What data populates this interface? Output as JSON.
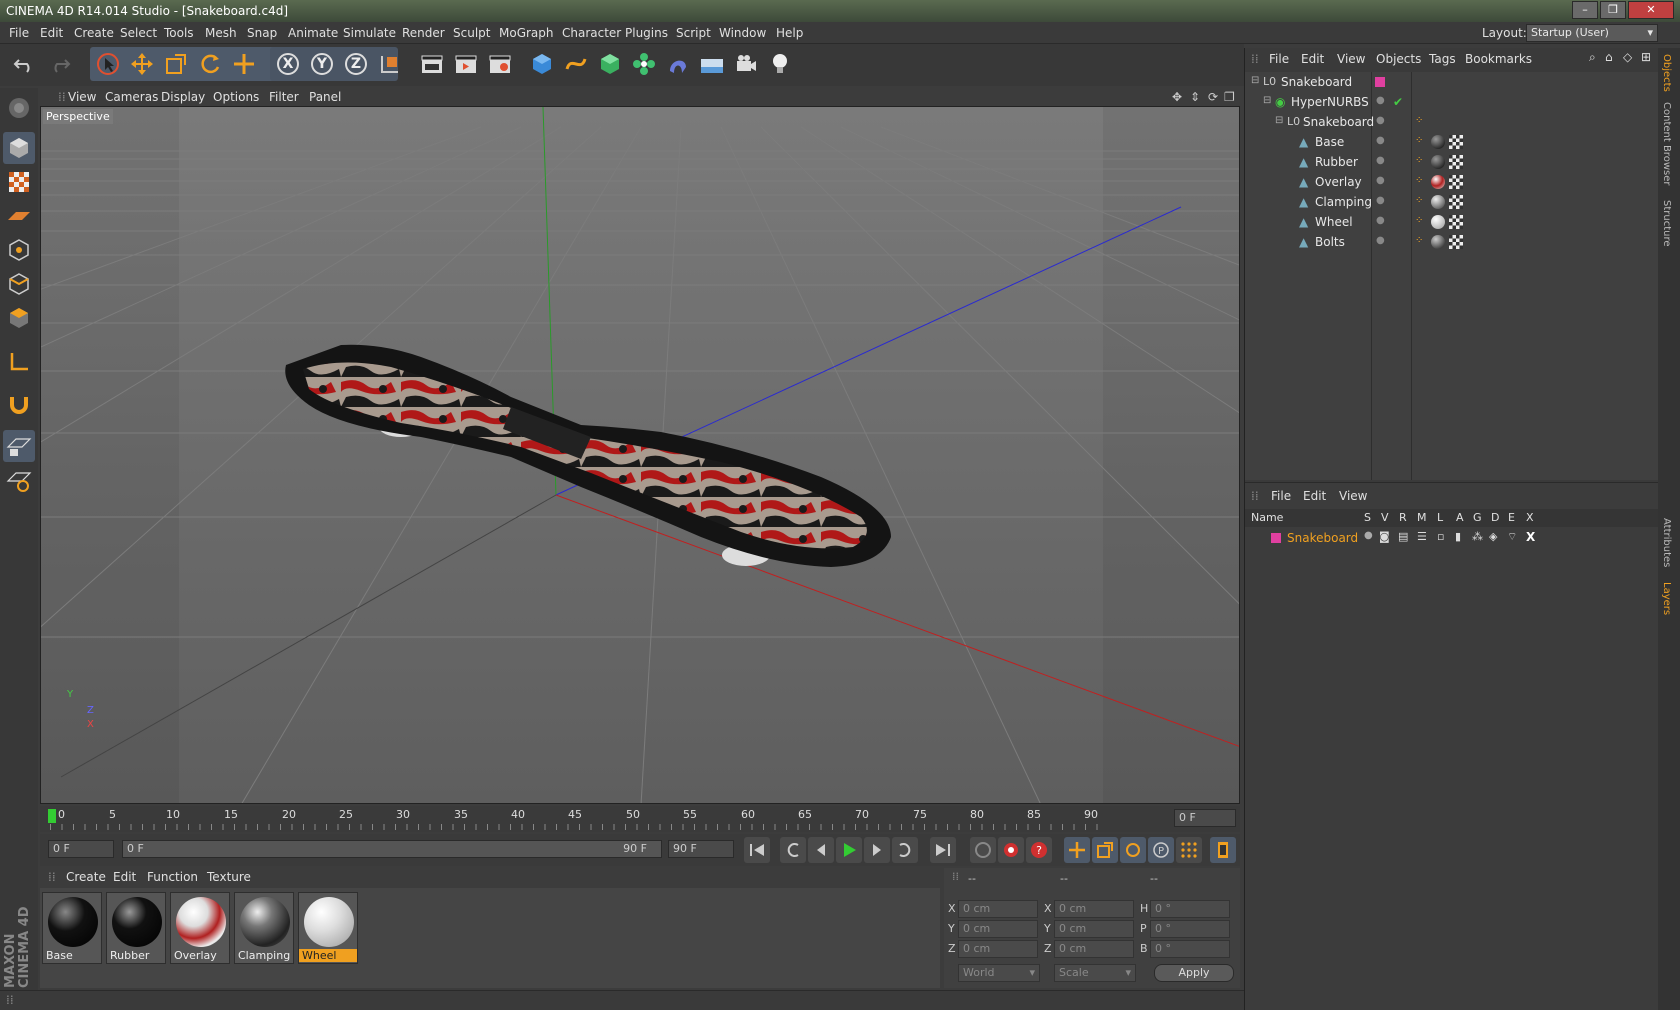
{
  "window": {
    "title": "CINEMA 4D R14.014 Studio - [Snakeboard.c4d]",
    "minimize": "–",
    "maximize": "❐",
    "close": "✕"
  },
  "menubar": [
    "File",
    "Edit",
    "Create",
    "Select",
    "Tools",
    "Mesh",
    "Snap",
    "Animate",
    "Simulate",
    "Render",
    "Sculpt",
    "MoGraph",
    "Character",
    "Plugins",
    "Script",
    "Window",
    "Help"
  ],
  "layout": {
    "label": "Layout:",
    "value": "Startup (User)"
  },
  "toolbar": {
    "axis_x": "X",
    "axis_y": "Y",
    "axis_z": "Z"
  },
  "viewport": {
    "menu": [
      "View",
      "Cameras",
      "Display",
      "Options",
      "Filter",
      "Panel"
    ],
    "label": "Perspective",
    "axis_y": "Y",
    "axis_z": "Z",
    "axis_x": "X"
  },
  "timeline": {
    "ticks": [
      "0",
      "5",
      "10",
      "15",
      "20",
      "25",
      "30",
      "35",
      "40",
      "45",
      "50",
      "55",
      "60",
      "65",
      "70",
      "75",
      "80",
      "85",
      "90"
    ],
    "current_frame": "0 F",
    "start": "0 F",
    "range_start": "0 F",
    "range_end": "90 F",
    "end": "90 F"
  },
  "materials": {
    "menu": [
      "Create",
      "Edit",
      "Function",
      "Texture"
    ],
    "items": [
      {
        "name": "Base"
      },
      {
        "name": "Rubber"
      },
      {
        "name": "Overlay"
      },
      {
        "name": "Clamping"
      },
      {
        "name": "Wheel"
      }
    ],
    "selected": "Wheel"
  },
  "coords": {
    "header_1": "--",
    "header_2": "--",
    "header_3": "--",
    "x": "X",
    "y": "Y",
    "z": "Z",
    "x2": "X",
    "y2": "Y",
    "z2": "Z",
    "h": "H",
    "p": "P",
    "b": "B",
    "pos_x": "0 cm",
    "pos_y": "0 cm",
    "pos_z": "0 cm",
    "size_x": "0 cm",
    "size_y": "0 cm",
    "size_z": "0 cm",
    "rot_h": "0 °",
    "rot_p": "0 °",
    "rot_b": "0 °",
    "mode_world": "World",
    "mode_scale": "Scale",
    "apply": "Apply"
  },
  "objects": {
    "menu": [
      "File",
      "Edit",
      "View",
      "Objects",
      "Tags",
      "Bookmarks"
    ],
    "tree": [
      {
        "name": "Snakeboard"
      },
      {
        "name": "HyperNURBS"
      },
      {
        "name": "Snakeboard"
      },
      {
        "name": "Base"
      },
      {
        "name": "Rubber"
      },
      {
        "name": "Overlay"
      },
      {
        "name": "Clamping"
      },
      {
        "name": "Wheel"
      },
      {
        "name": "Bolts"
      }
    ]
  },
  "layers": {
    "menu": [
      "File",
      "Edit",
      "View"
    ],
    "columns": [
      "Name",
      "S",
      "V",
      "R",
      "M",
      "L",
      "A",
      "G",
      "D",
      "E",
      "X"
    ],
    "row_name": "Snakeboard"
  },
  "sidetabs": [
    "Objects",
    "Content Browser",
    "Structure",
    "Attributes",
    "Layers"
  ],
  "brand": "MAXON CINEMA 4D",
  "colors": {
    "accent": "#f0a020",
    "selected_material": "#f0a020",
    "layer_color": "#e040a0"
  }
}
